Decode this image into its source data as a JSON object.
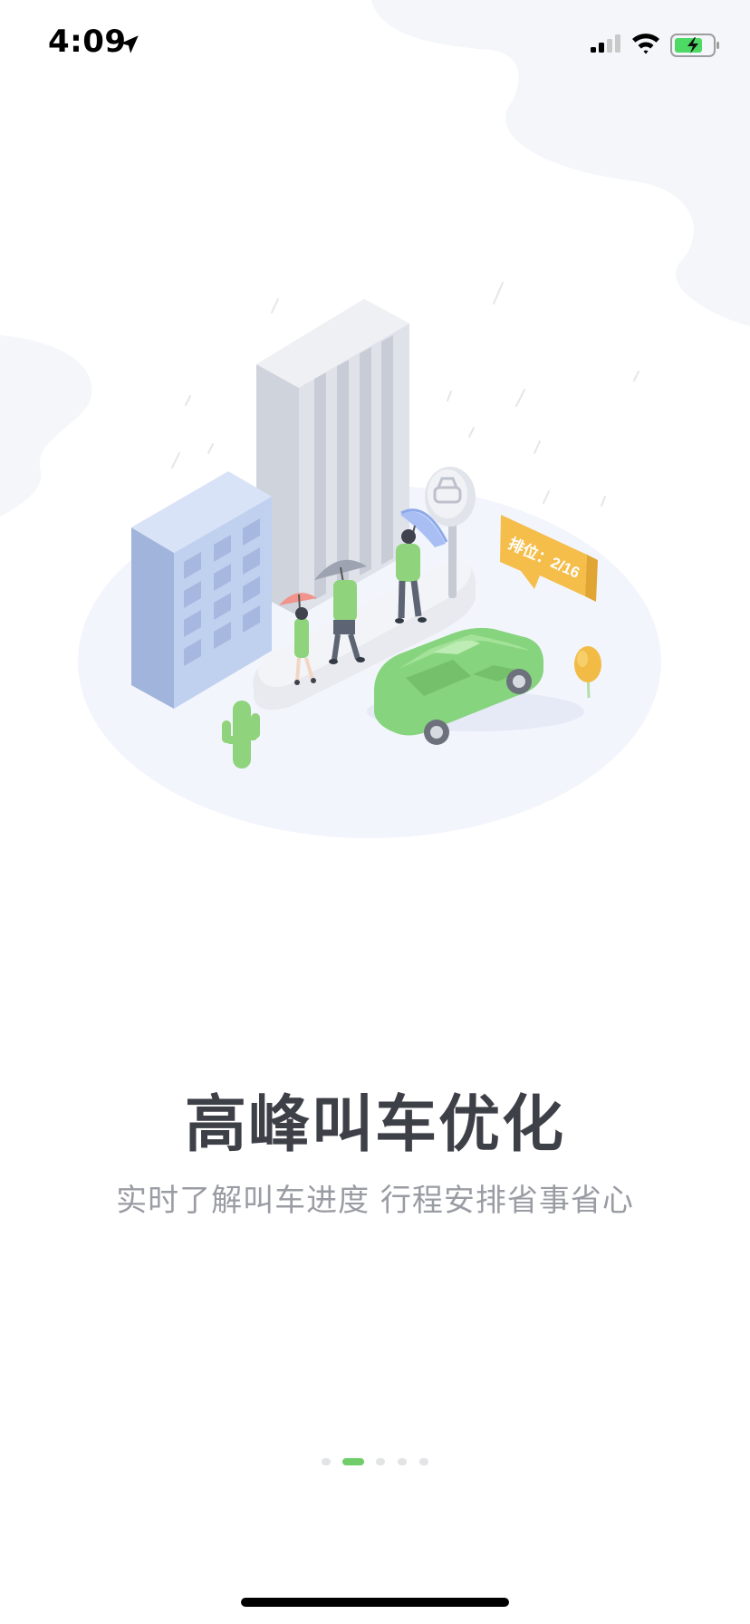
{
  "status_bar": {
    "time": "4:09",
    "icons": [
      "location-arrow-icon",
      "cellular-signal-icon",
      "wifi-icon",
      "battery-charging-icon"
    ]
  },
  "illustration": {
    "queue_badge_text": "排位：2/16",
    "bus_stop_sign_icon": "car-icon"
  },
  "onboarding": {
    "title": "高峰叫车优化",
    "subtitle": "实时了解叫车进度 行程安排省事省心"
  },
  "pager": {
    "total_pages": 5,
    "current_page": 2
  },
  "colors": {
    "accent_green": "#6fce6a",
    "title_text": "#3e4048",
    "subtitle_text": "#9a9ca3",
    "badge_orange": "#f5bd4a"
  }
}
